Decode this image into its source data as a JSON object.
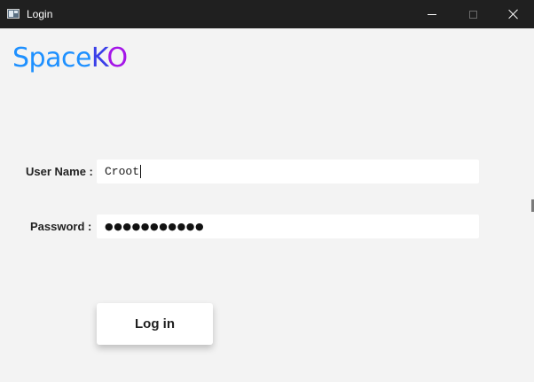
{
  "window": {
    "title": "Login",
    "icon": "app-window-icon",
    "controls": {
      "minimize_icon": "minimize-icon",
      "maximize_icon": "maximize-icon",
      "close_icon": "close-icon"
    }
  },
  "brand": {
    "part1": "Space",
    "part2": "K",
    "part3": "O",
    "colors": {
      "part1": "#1e90ff",
      "part2": "#3a3fe8",
      "part3": "#a415e8"
    }
  },
  "form": {
    "username_label": "User Name :",
    "username_value": "Croot",
    "password_label": "Password :",
    "password_mask": "●●●●●●●●●●●",
    "login_button_label": "Log in"
  },
  "colors": {
    "background": "#f3f3f3",
    "titlebar": "#202020",
    "input_background": "#ffffff"
  }
}
